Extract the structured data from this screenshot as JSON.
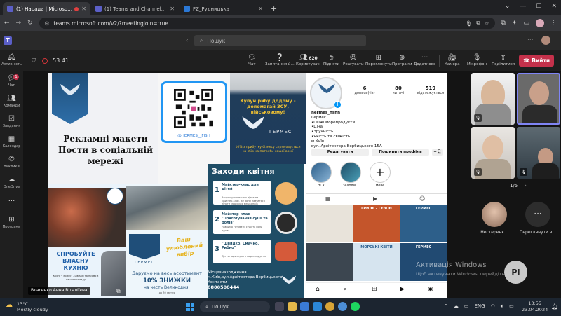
{
  "browser": {
    "tabs": [
      {
        "label": "(1) Нарада | Microsoft Tea",
        "active": true,
        "recording": true
      },
      {
        "label": "(1) Teams and Channels | Д",
        "active": false
      },
      {
        "label": "FZ_Рудницька",
        "active": false
      }
    ],
    "new_tab": "+",
    "url": "teams.microsoft.com/v2/?meetingjoin=true"
  },
  "teams": {
    "search_placeholder": "Пошук",
    "rail": [
      {
        "label": "Активність",
        "icon": "bell-icon"
      },
      {
        "label": "Чат",
        "icon": "chat-icon",
        "badge": "1"
      },
      {
        "label": "Команди",
        "icon": "teams-icon"
      },
      {
        "label": "Завдання",
        "icon": "tasks-icon"
      },
      {
        "label": "Календар",
        "icon": "calendar-icon"
      },
      {
        "label": "Виклики",
        "icon": "phone-icon"
      },
      {
        "label": "OneDrive",
        "icon": "cloud-icon"
      },
      {
        "label": "",
        "icon": "more-icon"
      },
      {
        "label": "Програми",
        "icon": "apps-icon"
      }
    ],
    "meeting": {
      "timer": "53:41",
      "controls": [
        {
          "label": "Чат",
          "icon": "chat-icon"
        },
        {
          "label": "Запитання й...",
          "icon": "qa-icon"
        },
        {
          "label": "Користувачі",
          "icon": "people-icon",
          "count": "620"
        },
        {
          "label": "Підняти",
          "icon": "hand-icon"
        },
        {
          "label": "Реагувати",
          "icon": "smile-icon"
        },
        {
          "label": "Переглянути",
          "icon": "view-icon"
        },
        {
          "label": "Програми",
          "icon": "apps-icon"
        },
        {
          "label": "Додатково",
          "icon": "more-icon"
        },
        {
          "label": "Камера",
          "icon": "camera-off-icon"
        },
        {
          "label": "Мікрофон",
          "icon": "mic-off-icon"
        },
        {
          "label": "Поділитися",
          "icon": "share-icon"
        }
      ],
      "leave_label": "Вийти",
      "pager": "1/5",
      "participants": [
        {
          "name": "Нестеренк..."
        },
        {
          "name": "Переглянути в..."
        }
      ],
      "pi_initials": "PI",
      "presenter_name": "Власенко Анна Віталіївна"
    },
    "watermark": {
      "line1": "Активація Windows",
      "line2": "Щоб активувати Windows, перейдіть до..."
    }
  },
  "slide": {
    "title": "Рекламні макети Пости в соціальній мережі",
    "qr_handle": "@HERMES__FISH",
    "fish_poster": {
      "headline": "Купуй рибу додому - допомагай ЗСУ, військовому!",
      "brand": "ГЕРМЕС",
      "footer": "10% з прибутку бізнесу спрямовується на збір на потреби нашої армії"
    },
    "menu": {
      "title": "Заходи квітня",
      "items": [
        {
          "num": "1",
          "title": "Майстер-клас для дітей",
          "sub": "Запрошуємо ваших діток на майстер-клас, де вони навчаться ліпити морських мешканців"
        },
        {
          "num": "2",
          "title": "Майстер-клас \"Приготування суші та ролів\"",
          "sub": "Навчимо готувати суші та роли вдома"
        },
        {
          "num": "3",
          "title": "\"Швидко, Смачно, Рибно\"",
          "sub": "Дегустація страв з морепродуктів"
        }
      ],
      "contacts_heading": "Місцезнаходження",
      "address": "м.Київ,вул.Архітектора Вербицького",
      "contacts_label": "Контакти",
      "phone": "0800500444"
    },
    "try_poster": {
      "headline": "СПРОБУЙТЕ ВЛАСНУ КУХНЮ",
      "sub": "Кухні \"Гермес\" - швидкі та прямо з нашого складу"
    },
    "discount_poster": {
      "slogan": "Ваш улюблений вибір",
      "line1": "Даруємо на весь асортимент",
      "line2": "10% ЗНИЖКИ",
      "line3": "на честь Великодня!",
      "small": "до 30 квітня",
      "brand": "ГЕРМЕС"
    },
    "instagram": {
      "stats": [
        {
          "value": "6",
          "label": "дописи(-ів)"
        },
        {
          "value": "80",
          "label": "читачі"
        },
        {
          "value": "519",
          "label": "відстежується"
        }
      ],
      "username": "hermes_fishh",
      "bio": [
        "Гермес",
        "•Свіжі морепродукти",
        "•Ціна",
        "•Зручність",
        "•Якість та свіжість",
        "м.Київ",
        "вул. Архітектора Вербицького 15А"
      ],
      "edit_button": "Редагувати",
      "share_button": "Поширити профіль",
      "highlights": [
        {
          "label": "ЗСУ"
        },
        {
          "label": "Заходи..."
        },
        {
          "label": "Нове"
        }
      ],
      "grid": [
        {
          "text": "",
          "color": "#e8e3da"
        },
        {
          "text": "ГРИЛЬ - СЕЗОН",
          "color": "#c4552b"
        },
        {
          "text": "ГЕРМЕС",
          "color": "#2d5f8a"
        },
        {
          "text": "",
          "color": "#3c4650"
        },
        {
          "text": "МОРСЬКІ КВІТИ",
          "color": "#d6e4ef"
        },
        {
          "text": "ГЕРМЕС",
          "color": "#214a72"
        }
      ]
    }
  },
  "taskbar": {
    "temp": "13°C",
    "weather": "Mostly cloudy",
    "search": "Пошук",
    "lang": "ENG",
    "time": "13:55",
    "date": "23.04.2024"
  }
}
